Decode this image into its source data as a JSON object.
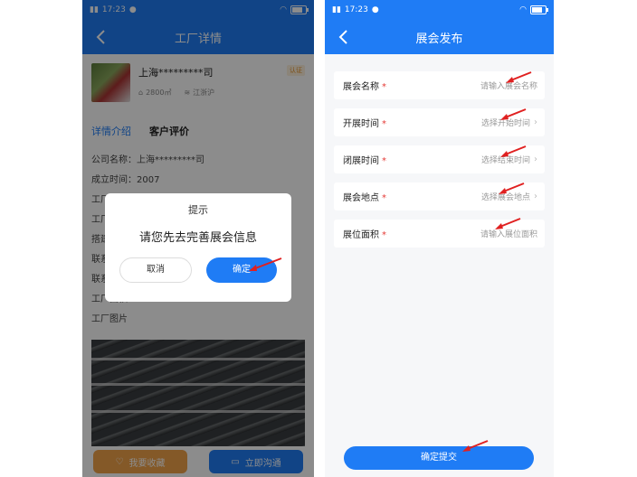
{
  "colors": {
    "primary": "#1f7cf5",
    "accent_orange": "#f0a24a",
    "required": "#e53935",
    "annotation_arrow": "#e02020"
  },
  "status_bar": {
    "time": "17:23"
  },
  "left_screen": {
    "nav_title": "工厂详情",
    "factory": {
      "name": "上海*********司",
      "area": "2800㎡",
      "region": "江浙沪",
      "tag": "认证"
    },
    "tabs": [
      {
        "label": "详情介绍"
      },
      {
        "label": "客户评价"
      }
    ],
    "details": [
      "公司名称：上海*********司",
      "成立时间：2007",
      "工厂",
      "工厂",
      "搭建",
      "联系",
      "联系",
      "工厂面积：2800m²",
      "工厂图片"
    ],
    "bottom": {
      "favorite_label": "我要收藏",
      "chat_label": "立即沟通"
    },
    "dialog": {
      "title": "提示",
      "message": "请您先去完善展会信息",
      "cancel_label": "取消",
      "confirm_label": "确定"
    }
  },
  "right_screen": {
    "nav_title": "展会发布",
    "form": [
      {
        "label": "展会名称",
        "required": "*",
        "placeholder": "请输入展会名称",
        "chevron": false
      },
      {
        "label": "开展时间",
        "required": "*",
        "placeholder": "选择开始时间",
        "chevron": true
      },
      {
        "label": "闭展时间",
        "required": "*",
        "placeholder": "选择结束时间",
        "chevron": true
      },
      {
        "label": "展会地点",
        "required": "*",
        "placeholder": "选择展会地点",
        "chevron": true
      },
      {
        "label": "展位面积",
        "required": "*",
        "placeholder": "请输入展位面积",
        "chevron": false
      }
    ],
    "submit_label": "确定提交"
  }
}
